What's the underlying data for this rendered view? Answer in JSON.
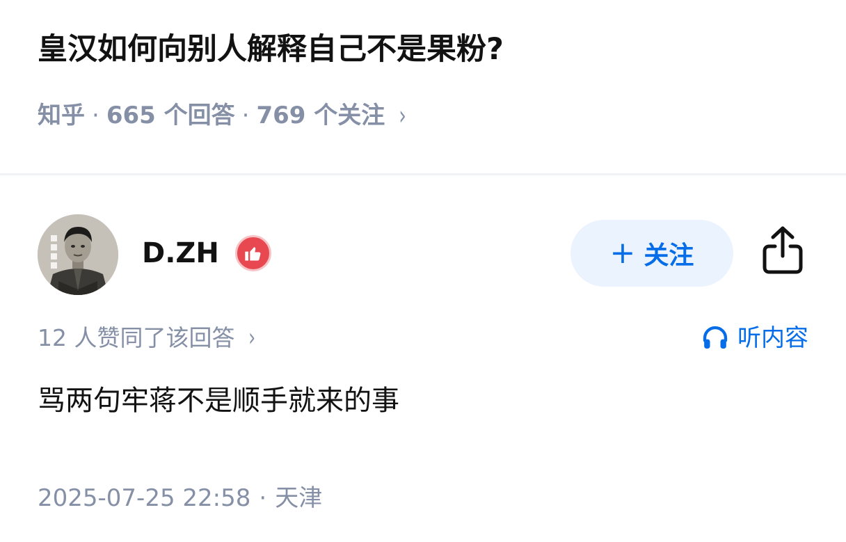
{
  "question": {
    "title": "皇汉如何向别人解释自己不是果粉?",
    "source": "知乎",
    "answers": "665 个回答",
    "followers": "769 个关注",
    "chevron": "›"
  },
  "author": {
    "name": "D.ZH",
    "badge_icon": "thumbs-up-icon",
    "follow_label": "关注",
    "follow_plus": "+",
    "share_icon": "share-icon"
  },
  "answer": {
    "voters": "12 人赞同了该回答",
    "voters_chevron": "›",
    "listen_label": "听内容",
    "content": "骂两句牢蒋不是顺手就来的事",
    "timestamp": "2025-07-25 22:58",
    "location": "天津"
  },
  "colors": {
    "accent": "#056de8",
    "muted": "#8590a6",
    "badge": "#e8484f",
    "follow_bg": "#ebf3fe"
  }
}
